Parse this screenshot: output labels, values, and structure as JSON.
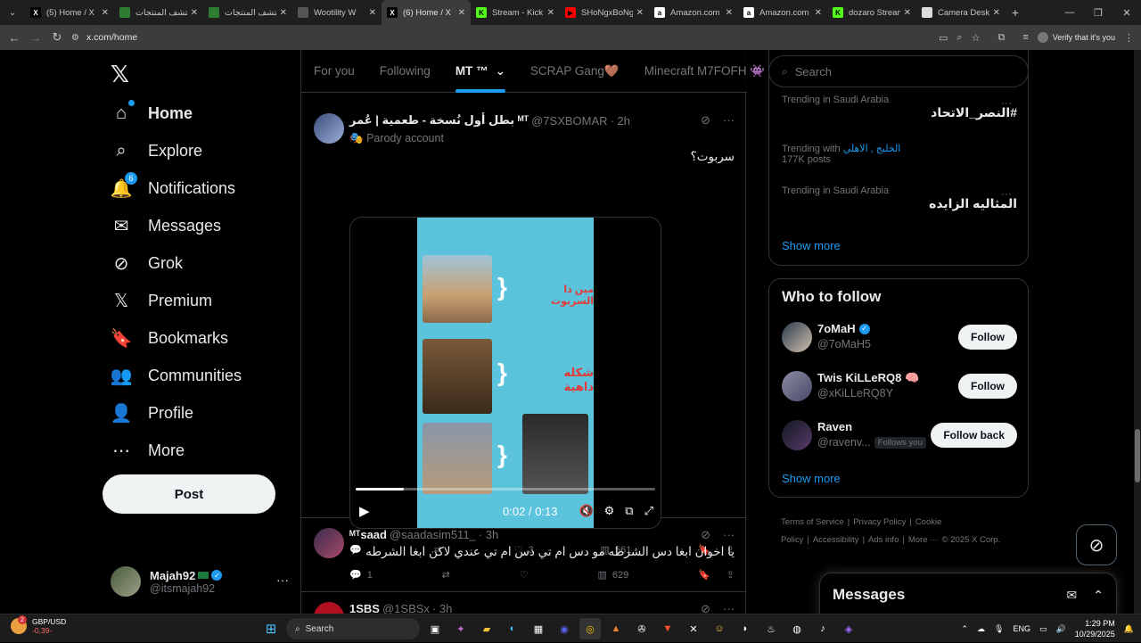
{
  "browser": {
    "tabs": [
      {
        "label": "(5) Home / X",
        "fav": "X",
        "fav_color": "#000000",
        "active": false
      },
      {
        "label": "اكتشف المنتجات",
        "fav": "",
        "fav_color": "#2e7d32",
        "active": false
      },
      {
        "label": "اكتشف المنتجات",
        "fav": "",
        "fav_color": "#2e7d32",
        "active": false
      },
      {
        "label": "Wootility W",
        "fav": "",
        "fav_color": "#555555",
        "active": false
      },
      {
        "label": "(6) Home / X",
        "fav": "X",
        "fav_color": "#000000",
        "active": true
      },
      {
        "label": "Stream - Kick",
        "fav": "K",
        "fav_color": "#53fc18",
        "active": false
      },
      {
        "label": "SHoNgxBoNg",
        "fav": "▶",
        "fav_color": "#ff0000",
        "active": false
      },
      {
        "label": "Amazon.com",
        "fav": "a",
        "fav_color": "#ffffff",
        "active": false
      },
      {
        "label": "Amazon.com",
        "fav": "a",
        "fav_color": "#ffffff",
        "active": false
      },
      {
        "label": "dozaro Stream",
        "fav": "K",
        "fav_color": "#53fc18",
        "active": false
      },
      {
        "label": "Camera Desk",
        "fav": "",
        "fav_color": "#dddddd",
        "active": false
      }
    ],
    "url": "x.com/home",
    "profile_label": "Verify that it's you"
  },
  "nav": {
    "items": [
      {
        "label": "Home",
        "icon": "⌂",
        "icon_name": "home-icon",
        "active": true
      },
      {
        "label": "Explore",
        "icon": "⌕",
        "icon_name": "search-icon"
      },
      {
        "label": "Notifications",
        "icon": "🔔",
        "icon_name": "bell-icon",
        "badge": "6"
      },
      {
        "label": "Messages",
        "icon": "✉",
        "icon_name": "envelope-icon"
      },
      {
        "label": "Grok",
        "icon": "⊘",
        "icon_name": "grok-icon"
      },
      {
        "label": "Premium",
        "icon": "𝕏",
        "icon_name": "x-premium-icon"
      },
      {
        "label": "Bookmarks",
        "icon": "🔖",
        "icon_name": "bookmark-icon"
      },
      {
        "label": "Communities",
        "icon": "👥",
        "icon_name": "communities-icon"
      },
      {
        "label": "Profile",
        "icon": "👤",
        "icon_name": "person-icon"
      },
      {
        "label": "More",
        "icon": "⋯",
        "icon_name": "more-circle-icon"
      }
    ],
    "post_label": "Post",
    "account": {
      "name": "Majah92",
      "handle": "@itsmajah92"
    }
  },
  "feed": {
    "tabs": [
      {
        "label": "For you",
        "active": false
      },
      {
        "label": "Following",
        "active": false
      },
      {
        "label": "MT ™",
        "active": true
      },
      {
        "label": "SCRAP Gang🤎",
        "active": false
      },
      {
        "label": "Minecraft M7FOFH 👾",
        "active": false
      }
    ],
    "tweet1": {
      "name": "بطل أول نُسخة - طعمية | عُمر ᴹᵀ",
      "handle": "@7SXBOMAR",
      "time": "· 2h",
      "parody": "Parody account",
      "text": "سربوت؟",
      "video": {
        "cap1": "مين ذا السربوت",
        "cap2": "شكله داهية",
        "time": "0:02 / 0:13",
        "progress": 0.16
      },
      "replies": "",
      "reposts": "",
      "likes": "3",
      "views": "561"
    },
    "tweet2": {
      "name": "ᴹᵀsaad",
      "handle": "@saadasim511_",
      "time": "· 3h",
      "text": "يا اخوان ابغا دس الشرطه مو دس ام تي دس ام تي عندي لاكن ابغا الشرطه",
      "replies": "1",
      "views": "629"
    },
    "tweet3": {
      "name": "1SBS",
      "handle": "@1SBSx",
      "time": "· 3h"
    }
  },
  "sidebar": {
    "search_placeholder": "Search",
    "trends": [
      {
        "context": "Trending in Saudi Arabia",
        "title": "#النصر_الاتحاد",
        "posts": ""
      },
      {
        "context": "Trending with",
        "context_link": "الخليج , الاهلي",
        "title": "",
        "posts": "177K posts"
      },
      {
        "context": "Trending in Saudi Arabia",
        "title": "المثاليه الزايده",
        "posts": ""
      }
    ],
    "show_more": "Show more",
    "who_to_follow": {
      "title": "Who to follow",
      "users": [
        {
          "name": "7oMaH",
          "handle": "@7oMaH5",
          "verified": true,
          "button": "Follow",
          "follows_you": ""
        },
        {
          "name": "Twis KiLLeRQ8 🧠",
          "handle": "@xKiLLeRQ8Y",
          "verified": false,
          "button": "Follow",
          "follows_you": ""
        },
        {
          "name": "Raven",
          "handle": "@ravenv...",
          "verified": false,
          "button": "Follow back",
          "follows_you": "Follows you"
        }
      ],
      "show_more": "Show more"
    },
    "footer": [
      "Terms of Service",
      "|",
      "Privacy Policy",
      "|",
      "Cookie Policy",
      "|",
      "Accessibility",
      "|",
      "Ads info",
      "|",
      "More ···",
      "© 2025 X Corp."
    ]
  },
  "messages": {
    "title": "Messages"
  },
  "taskbar": {
    "weather_line1": "GBP/USD",
    "weather_line2": "-0,39-",
    "weather_badge": "2",
    "search_label": "Search",
    "lang": "ENG",
    "time": "1:29 PM",
    "date": "10/29/2025"
  }
}
